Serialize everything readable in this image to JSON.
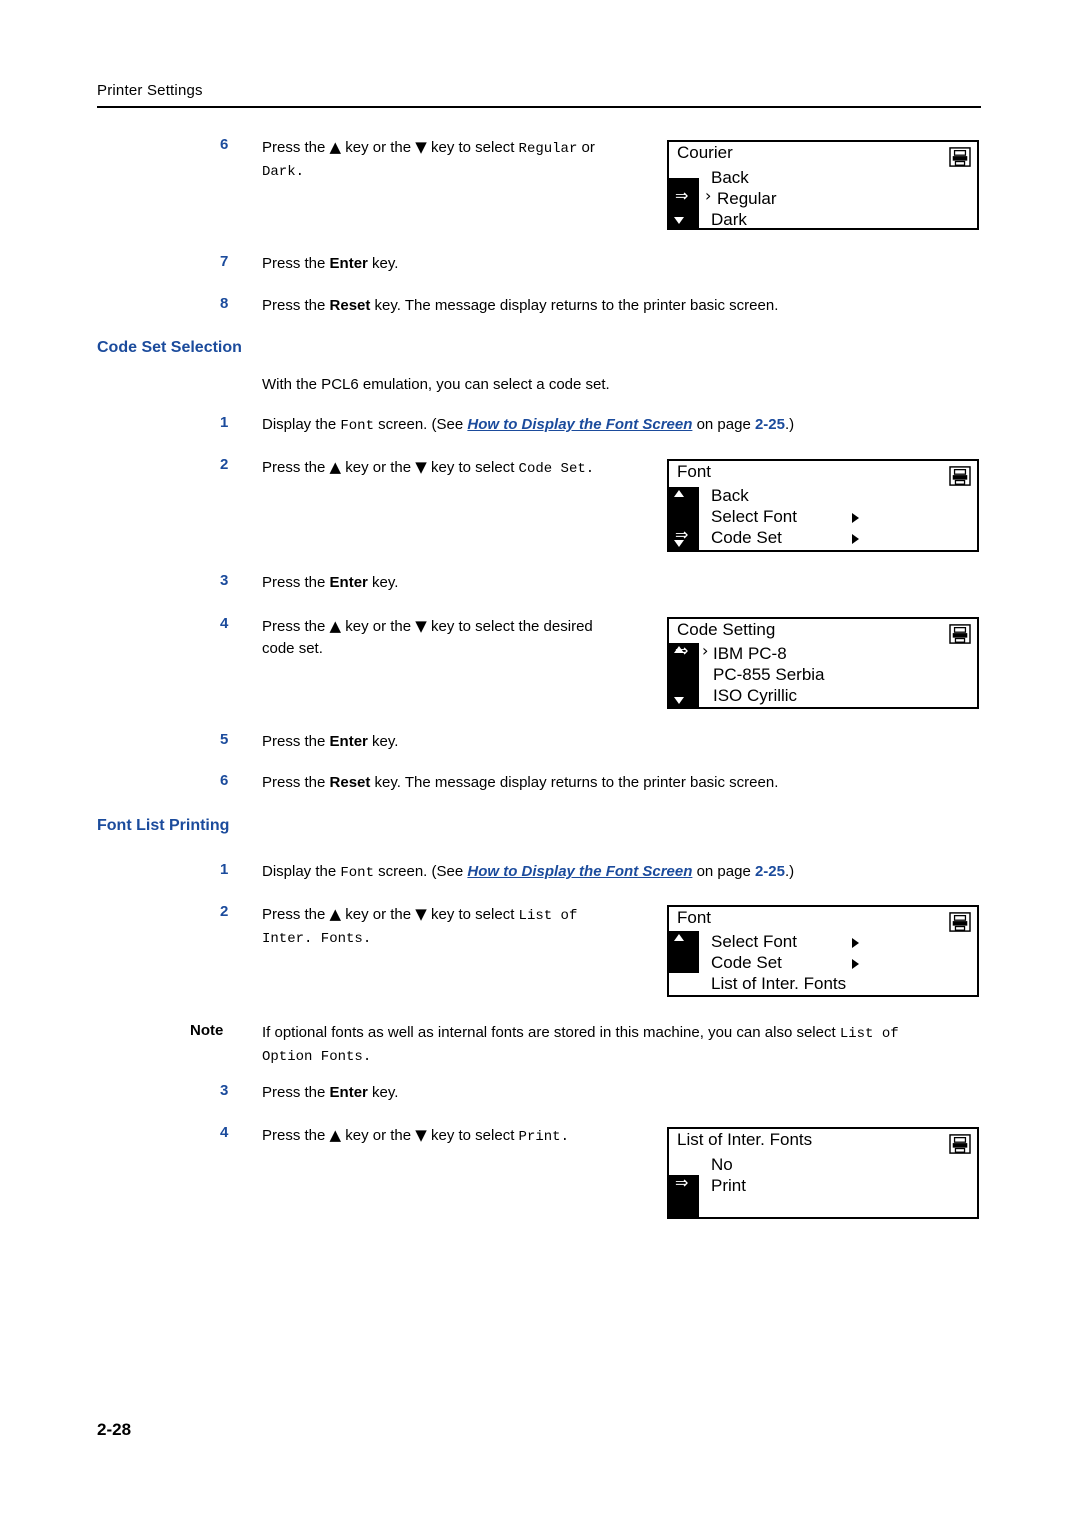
{
  "header": {
    "title": "Printer Settings"
  },
  "page_number": "2-28",
  "steps_top": [
    {
      "num": "6",
      "text_pre": "Press the ",
      "tri_up": "▲",
      "mid1": " key or the ",
      "tri_dn": "▼",
      "mid2": " key to select ",
      "mono1": "Regular",
      "mid3": " or ",
      "mono2": "Dark",
      "tail": "."
    },
    {
      "num": "7",
      "text_pre": "Press the ",
      "bold": "Enter",
      "tail": " key."
    },
    {
      "num": "8",
      "text_pre": "Press the ",
      "bold": "Reset",
      "tail": " key. The message display returns to the printer basic screen."
    }
  ],
  "section_code_set": {
    "title": "Code Set Selection",
    "intro": "With the PCL6 emulation, you can select a code set.",
    "step1": {
      "num": "1",
      "pre": "Display the ",
      "mono": "Font",
      "mid": " screen. (See ",
      "link": "How to Display the Font Screen",
      "mid2": " on page ",
      "page": "2-25",
      "tail": ".)"
    },
    "step2": {
      "num": "2",
      "pre": "Press the ",
      "mid1": " key or the ",
      "mid2": " key to select ",
      "mono": "Code Set",
      "tail": "."
    },
    "step3": {
      "num": "3",
      "pre": "Press the ",
      "bold": "Enter",
      "tail": " key."
    },
    "step4": {
      "num": "4",
      "pre": "Press the ",
      "mid1": " key or the ",
      "mid2": " key to select the desired",
      "line2": "code set."
    },
    "step5": {
      "num": "5",
      "pre": "Press the ",
      "bold": "Enter",
      "tail": " key."
    },
    "step6": {
      "num": "6",
      "pre": "Press the ",
      "bold": "Reset",
      "tail": " key. The message display returns to the printer basic screen."
    }
  },
  "section_font_list": {
    "title": "Font List Printing",
    "step1": {
      "num": "1",
      "pre": "Display the ",
      "mono": "Font",
      "mid": " screen. (See ",
      "link": "How to Display the Font Screen",
      "mid2": " on page ",
      "page": "2-25",
      "tail": ".)"
    },
    "step2": {
      "num": "2",
      "pre": "Press the ",
      "mid1": " key or the ",
      "mid2": " key to select ",
      "mono": "List of",
      "mono_line2": "Inter. Fonts.",
      "tail": ""
    },
    "note": {
      "label": "Note",
      "pre": "If optional fonts as well as internal fonts are stored in this machine, you can also select ",
      "mono1": "List of",
      "mono2": "Option Fonts",
      "tail": "."
    },
    "step3": {
      "num": "3",
      "pre": "Press the ",
      "bold": "Enter",
      "tail": " key."
    },
    "step4": {
      "num": "4",
      "pre": "Press the ",
      "mid1": " key or the ",
      "mid2": " key to select ",
      "mono": "Print",
      "tail": "."
    }
  },
  "lcds": [
    {
      "id": "courier",
      "title": "Courier",
      "icon": "printer-icon",
      "lines": [
        {
          "text": "Back",
          "selected": false
        },
        {
          "text": "Regular",
          "selected": true,
          "marker": "〉"
        },
        {
          "text": "Dark",
          "selected": false
        }
      ],
      "scroll": {
        "up": false,
        "down": true
      }
    },
    {
      "id": "font-code-set",
      "title": "Font",
      "icon": "printer-icon",
      "lines": [
        {
          "text": "Back",
          "selected": false
        },
        {
          "text": "Select Font",
          "selected": false,
          "submenu": true
        },
        {
          "text": "Code Set",
          "selected": true,
          "submenu": true
        }
      ],
      "scroll": {
        "up": true,
        "down": true
      }
    },
    {
      "id": "code-setting",
      "title": "Code Setting",
      "icon": "printer-icon",
      "lines": [
        {
          "text": "IBM PC-8",
          "selected": true,
          "marker": "〉"
        },
        {
          "text": "PC-855 Serbia",
          "selected": false
        },
        {
          "text": "ISO Cyrillic",
          "selected": false
        }
      ],
      "scroll": {
        "up": true,
        "down": true
      }
    },
    {
      "id": "font-list-inter",
      "title": "Font",
      "icon": "printer-icon",
      "lines": [
        {
          "text": "Select Font",
          "selected": false,
          "submenu": true
        },
        {
          "text": "Code Set",
          "selected": false,
          "submenu": true
        },
        {
          "text": "List of Inter. Fonts",
          "selected": true
        }
      ],
      "scroll": {
        "up": true,
        "down": false
      }
    },
    {
      "id": "list-of-inter-fonts",
      "title": "List of Inter. Fonts",
      "icon": "printer-icon",
      "lines": [
        {
          "text": "No",
          "selected": false
        },
        {
          "text": "Print",
          "selected": true
        }
      ],
      "scroll": {
        "up": false,
        "down": false
      }
    }
  ]
}
